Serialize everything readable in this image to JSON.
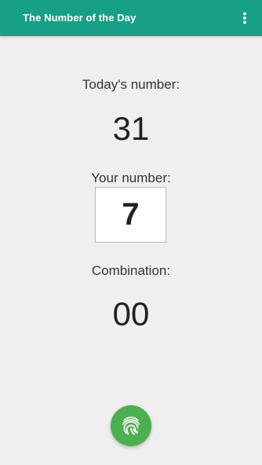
{
  "app_bar": {
    "title": "The Number of the Day",
    "overflow_icon": "more-vert-icon",
    "background_color": "#17a086"
  },
  "main": {
    "todays_label": "Today's number:",
    "todays_value": "31",
    "your_label": "Your number:",
    "your_value": "7",
    "combination_label": "Combination:",
    "combination_value": "00"
  },
  "fab": {
    "icon": "fingerprint-icon",
    "color": "#4caf50"
  }
}
